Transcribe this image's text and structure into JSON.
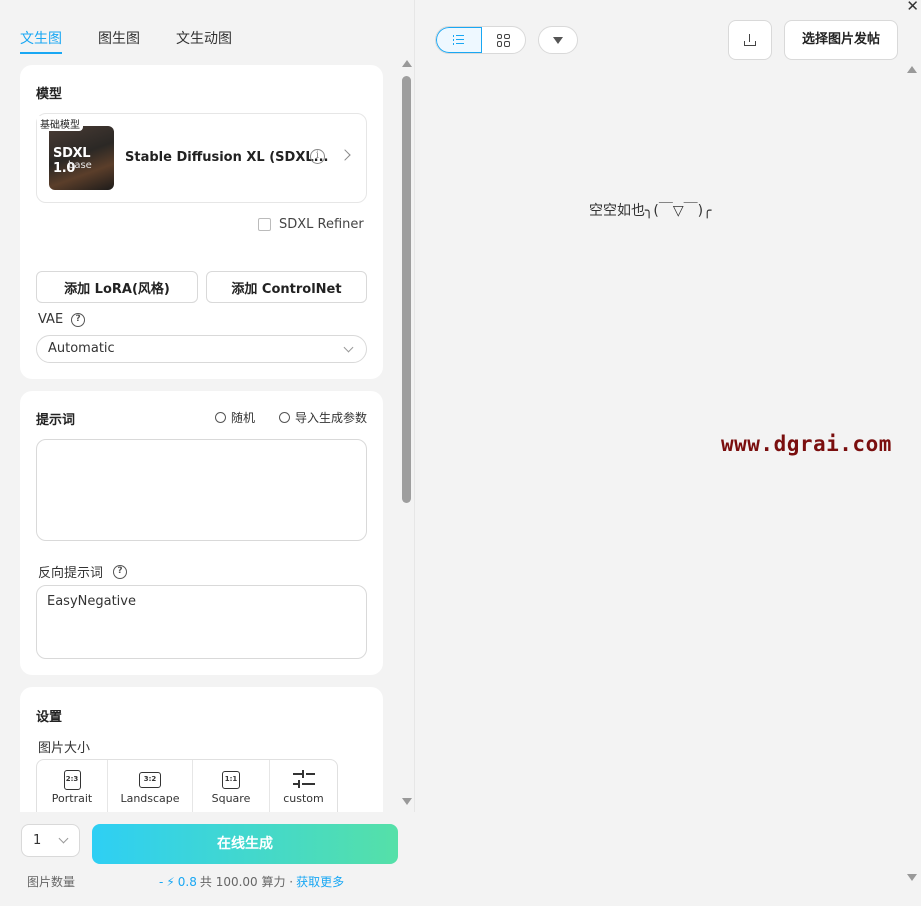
{
  "window": {
    "close_glyph": "✕"
  },
  "tabs": [
    {
      "label": "文生图",
      "active": true
    },
    {
      "label": "图生图",
      "active": false
    },
    {
      "label": "文生动图",
      "active": false
    }
  ],
  "model_card": {
    "title": "模型",
    "tag": "基础模型",
    "thumb_title": "SDXL 1.0",
    "thumb_sub": "base",
    "model_name": "Stable Diffusion XL (SDXL...",
    "refiner_label": "SDXL Refiner",
    "refiner_checked": false,
    "add_lora_label": "添加 LoRA(风格)",
    "add_controlnet_label": "添加 ControlNet",
    "vae_label": "VAE",
    "vae_value": "Automatic"
  },
  "prompt_card": {
    "title": "提示词",
    "random_label": "随机",
    "import_label": "导入生成参数",
    "prompt_value": "",
    "negative_label": "反向提示词",
    "negative_value": "EasyNegative"
  },
  "settings_card": {
    "title": "设置",
    "image_size_label": "图片大小",
    "sizes": [
      {
        "ratio": "2:3",
        "label": "Portrait"
      },
      {
        "ratio": "3:2",
        "label": "Landscape"
      },
      {
        "ratio": "1:1",
        "label": "Square"
      },
      {
        "ratio": "",
        "label": "custom"
      }
    ]
  },
  "footer": {
    "quantity_value": "1",
    "quantity_label": "图片数量",
    "generate_label": "在线生成",
    "cost_prefix": "-",
    "cost_value": "0.8",
    "total_text": "共 100.00 算力 ·",
    "get_more_label": "获取更多"
  },
  "right_panel": {
    "paste_label": "选择图片发帖",
    "empty_text": "空空如也╮(￣▽￣)╭",
    "watermark": "www.dgrai.com"
  },
  "colors": {
    "accent": "#19a7f3",
    "watermark": "#7a0e0e"
  }
}
